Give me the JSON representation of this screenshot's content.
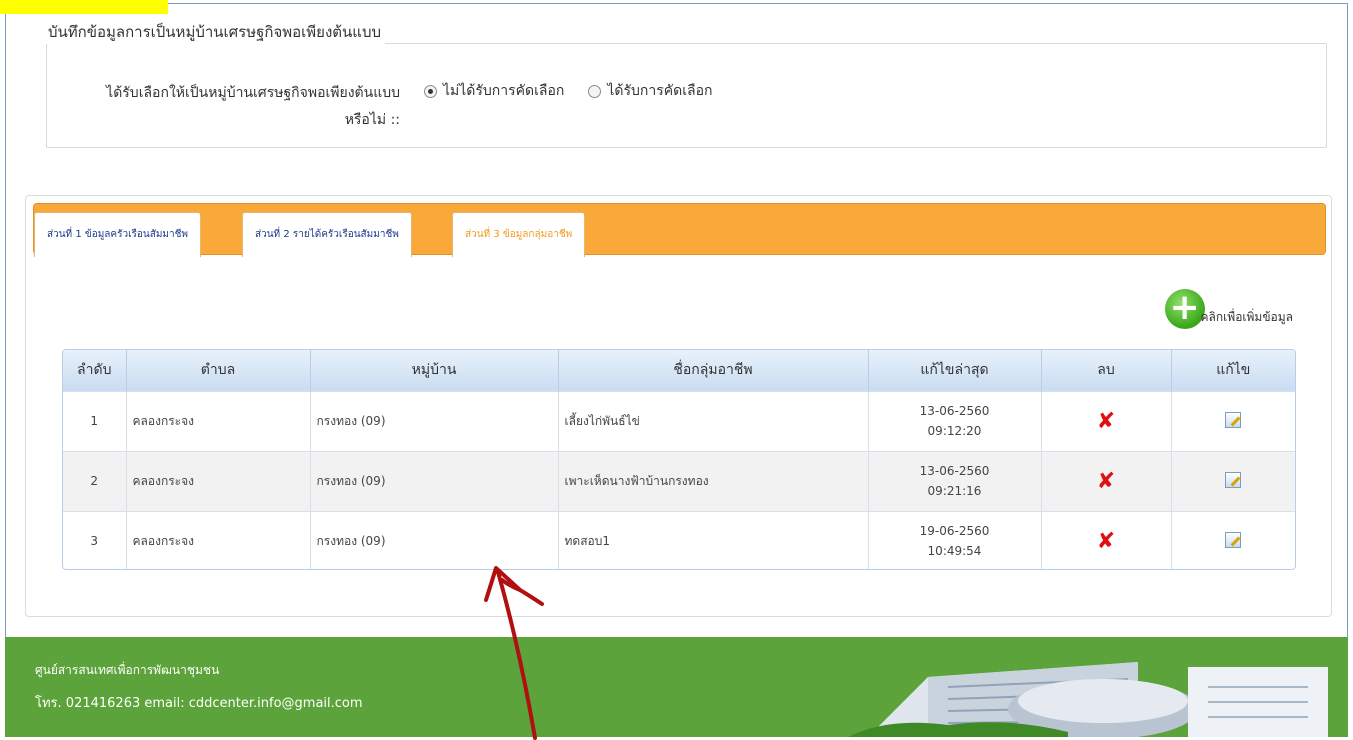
{
  "fieldset": {
    "legend": "บันทึกข้อมูลการเป็นหมู่บ้านเศรษฐกิจพอเพียงต้นแบบ",
    "question_line1": "ได้รับเลือกให้เป็นหมู่บ้านเศรษฐกิจพอเพียงต้นแบบ",
    "question_line2": "หรือไม่ ::",
    "options": [
      {
        "label": "ไม่ได้รับการคัดเลือก",
        "checked": true
      },
      {
        "label": "ได้รับการคัดเลือก",
        "checked": false
      }
    ]
  },
  "tabs": [
    {
      "label": "ส่วนที่ 1 ข้อมูลครัวเรือนสัมมาชีพ",
      "active": false
    },
    {
      "label": "ส่วนที่ 2 รายได้ครัวเรือนสัมมาชีพ",
      "active": false
    },
    {
      "label": "ส่วนที่ 3 ข้อมูลกลุ่มอาชีพ",
      "active": true
    }
  ],
  "add_link": {
    "label": "คลิกเพื่อเพิ่มข้อมูล",
    "icon": "plus-circle-icon"
  },
  "table": {
    "headers": [
      "ลำดับ",
      "ตำบล",
      "หมู่บ้าน",
      "ชื่อกลุ่มอาชีพ",
      "แก้ไขล่าสุด",
      "ลบ",
      "แก้ไข"
    ],
    "rows": [
      {
        "no": "1",
        "subdistrict": "คลองกระจง",
        "village": "กรงทอง (09)",
        "group": "เลี้ยงไก่พันธ์ไข่",
        "date": "13-06-2560",
        "time": "09:12:20"
      },
      {
        "no": "2",
        "subdistrict": "คลองกระจง",
        "village": "กรงทอง (09)",
        "group": "เพาะเห็ดนางฟ้าบ้านกรงทอง",
        "date": "13-06-2560",
        "time": "09:21:16"
      },
      {
        "no": "3",
        "subdistrict": "คลองกระจง",
        "village": "กรงทอง (09)",
        "group": "ทดสอบ1",
        "date": "19-06-2560",
        "time": "10:49:54"
      }
    ]
  },
  "footer": {
    "org": "ศูนย์สารสนเทศเพื่อการพัฒนาชุมชน",
    "contact": "โทร. 021416263 email: cddcenter.info@gmail.com"
  },
  "colors": {
    "tabbar": "#f8a93a",
    "footer": "#5ba33a",
    "delete": "#e01010",
    "arrow": "#b01010"
  }
}
